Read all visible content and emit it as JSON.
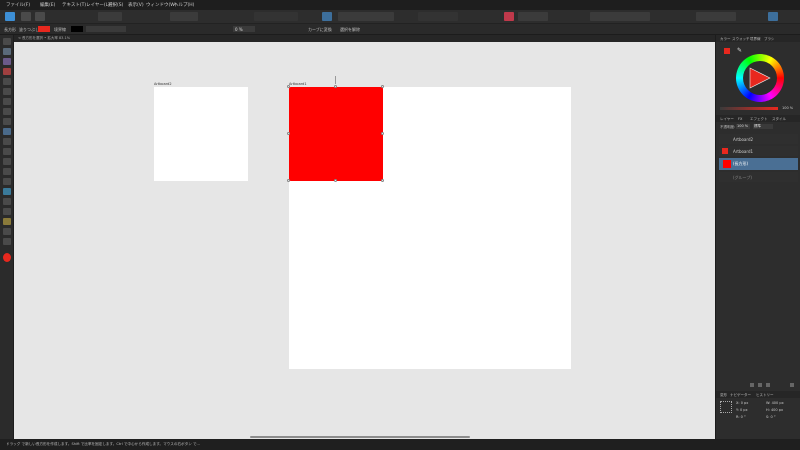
{
  "menu": [
    "ファイル(F)",
    "編集(E)",
    "テキスト(T)",
    "レイヤー(L)",
    "選択(S)",
    "表示(V)",
    "ウィンドウ(W)",
    "ヘルプ(H)"
  ],
  "context": {
    "artboard_label": "塗りつぶし",
    "stroke_label": "境界線",
    "fill_color": "#e8281e",
    "stroke_color": "#000000",
    "convert_label": "カーブに変換",
    "snap_label": "選択を解除",
    "corner_value": "0 %"
  },
  "path_text": "< 長方形を選択 • 拡大率 83.1%",
  "artboards": [
    {
      "title": "Artboard2"
    },
    {
      "title": "Artboard1"
    }
  ],
  "right_panel": {
    "tabs_top": [
      "カラー",
      "スウォッチ",
      "境界線",
      "ブラシ"
    ],
    "opacity_value": "100 %",
    "tabs_layers": [
      "レイヤー",
      "FX",
      "エフェクト",
      "スタイル"
    ],
    "layer_opacity": "100 %",
    "blend_mode": "標準",
    "layers": [
      {
        "name": "Artboard2",
        "selected": false
      },
      {
        "name": "Artboard1",
        "selected": false
      },
      {
        "name": "(長方形)",
        "selected": true
      },
      {
        "name": "(グループ)",
        "selected": false
      }
    ],
    "tabs_transform": [
      "変形",
      "ナビゲーター",
      "ヒストリー"
    ],
    "transform": {
      "x": "0 px",
      "y": "0 px",
      "w": "400 px",
      "h": "400 px",
      "r": "0 °",
      "s": "0 °"
    }
  },
  "status": "ドラッグ で新しい長方形を作成します。Shift で比率を固定します。Ctrl で中心から作成します。マウスの右ボタン で...",
  "colors": {
    "accent": "#3d6f9c",
    "red": "#ff0000",
    "canvas": "#e6e6e6"
  }
}
